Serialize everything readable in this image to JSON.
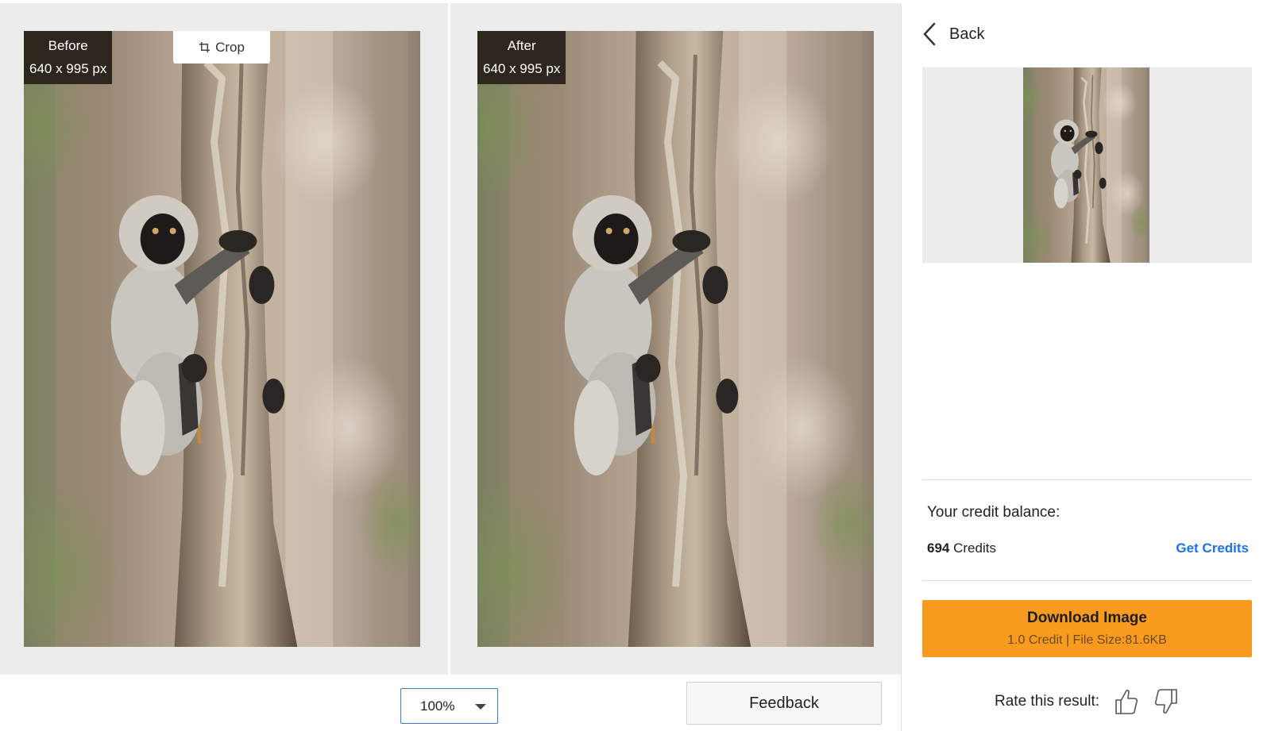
{
  "before_panel": {
    "label": "Before",
    "dimensions": "640 x 995 px",
    "crop_label": "Crop"
  },
  "after_panel": {
    "label": "After",
    "dimensions": "640 x 995 px"
  },
  "controls": {
    "zoom_value": "100%",
    "feedback_label": "Feedback"
  },
  "sidebar": {
    "back_label": "Back",
    "credit_balance_label": "Your credit balance:",
    "credit_count": "694",
    "credit_unit": "Credits",
    "get_credits_label": "Get Credits",
    "download_title": "Download Image",
    "download_subtitle": "1.0 Credit | File Size:81.6KB",
    "rate_label": "Rate this result:"
  },
  "colors": {
    "accent_orange": "#f79a1e",
    "link_blue": "#1a73e8",
    "zoom_border": "#3a7bd5"
  },
  "icons": {
    "crop": "crop-icon",
    "back": "chevron-left-icon",
    "zoom_caret": "caret-down-icon",
    "thumbs_up": "thumbs-up-icon",
    "thumbs_down": "thumbs-down-icon"
  }
}
